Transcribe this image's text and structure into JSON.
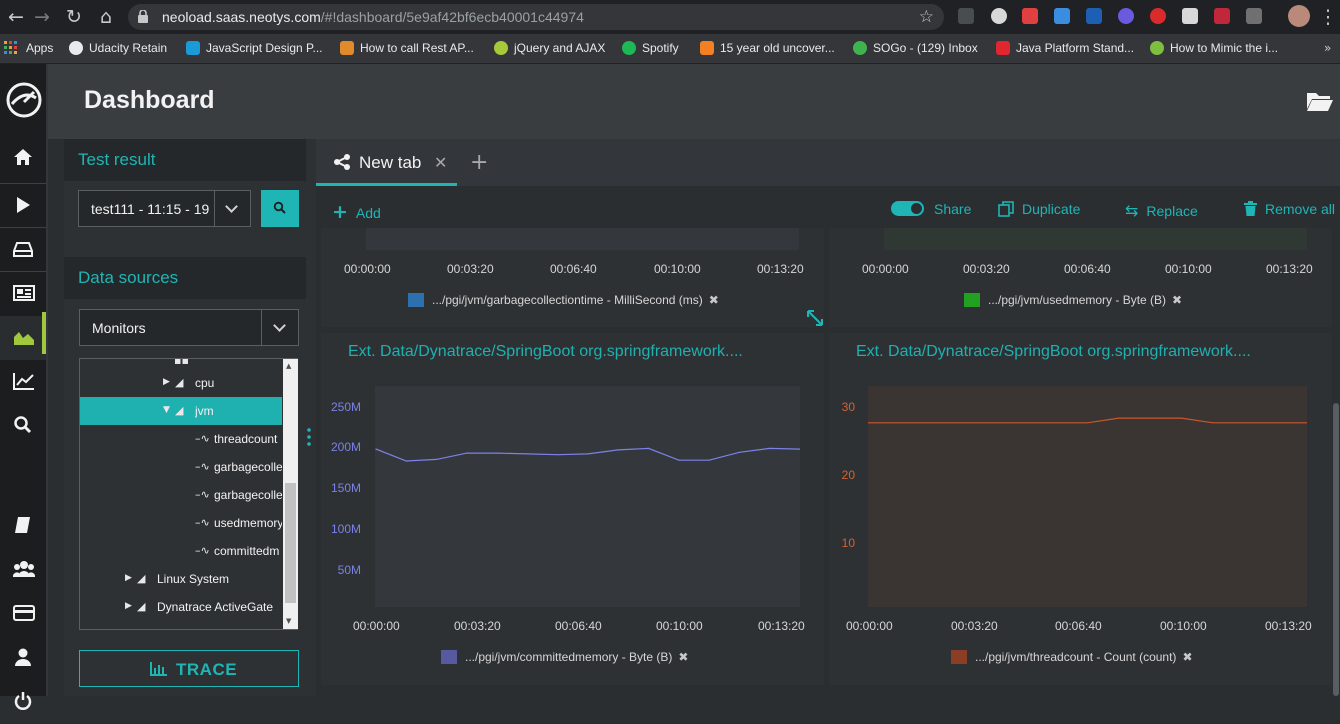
{
  "browser": {
    "url_host": "neoload.saas.neotys.com",
    "url_rest": "/#!dashboard/5e9af42bf6ecb40001c44974",
    "bookmarks": [
      {
        "label": "Apps",
        "color": "#e8a33c"
      },
      {
        "label": "Udacity Retain",
        "color": "#e8eaed"
      },
      {
        "label": "JavaScript Design P...",
        "color": "#1a9bd7"
      },
      {
        "label": "How to call Rest AP...",
        "color": "#e08a2b"
      },
      {
        "label": "jQuery and AJAX",
        "color": "#a6c93a"
      },
      {
        "label": "Spotify",
        "color": "#1db954"
      },
      {
        "label": "15 year old uncover...",
        "color": "#f48024"
      },
      {
        "label": "SOGo - (129) Inbox",
        "color": "#3fb34f"
      },
      {
        "label": "Java Platform Stand...",
        "color": "#e0262e"
      },
      {
        "label": "How to Mimic the i...",
        "color": "#7fbf3f"
      }
    ]
  },
  "app": {
    "title": "Dashboard"
  },
  "left_panel": {
    "test_result_heading": "Test result",
    "test_result_value": "test111 - 11:15 - 19",
    "data_sources_heading": "Data sources",
    "data_sources_value": "Monitors",
    "tree": [
      {
        "label": "cpu"
      },
      {
        "label": "jvm"
      },
      {
        "label": "threadcount"
      },
      {
        "label": "garbagecolle"
      },
      {
        "label": "garbagecolle"
      },
      {
        "label": "usedmemory"
      },
      {
        "label": "committedm"
      },
      {
        "label": "Linux System"
      },
      {
        "label": "Dynatrace ActiveGate"
      }
    ],
    "trace_label": "TRACE"
  },
  "tabs": {
    "active_label": "New tab"
  },
  "toolbar": {
    "add": "Add",
    "share": "Share",
    "duplicate": "Duplicate",
    "replace": "Replace",
    "remove_all": "Remove all"
  },
  "widgets": {
    "top_left": {
      "x_ticks": [
        "00:00:00",
        "00:03:20",
        "00:06:40",
        "00:10:00",
        "00:13:20"
      ],
      "legend": ".../pgi/jvm/garbagecollectiontime - MilliSecond (ms)",
      "color": "#2e6fae"
    },
    "top_right": {
      "x_ticks": [
        "00:00:00",
        "00:03:20",
        "00:06:40",
        "00:10:00",
        "00:13:20"
      ],
      "legend": ".../pgi/jvm/usedmemory - Byte (B)",
      "color": "#22a022"
    },
    "bottom_left": {
      "title": "Ext. Data/Dynatrace/SpringBoot org.springframework....",
      "y_ticks": [
        "250M",
        "200M",
        "150M",
        "100M",
        "50M"
      ],
      "x_ticks": [
        "00:00:00",
        "00:03:20",
        "00:06:40",
        "00:10:00",
        "00:13:20"
      ],
      "legend": ".../pgi/jvm/committedmemory - Byte (B)",
      "color": "#6c72d8"
    },
    "bottom_right": {
      "title": "Ext. Data/Dynatrace/SpringBoot org.springframework....",
      "y_ticks": [
        "30",
        "20",
        "10"
      ],
      "x_ticks": [
        "00:00:00",
        "00:03:20",
        "00:06:40",
        "00:10:00",
        "00:13:20"
      ],
      "legend": ".../pgi/jvm/threadcount - Count (count)",
      "color": "#c9562c"
    }
  },
  "chart_data": [
    {
      "type": "line",
      "x": [
        "00:00:00",
        "00:00:50",
        "00:01:40",
        "00:02:30",
        "00:03:20",
        "00:04:10",
        "00:05:00",
        "00:05:50",
        "00:06:40",
        "00:07:30",
        "00:08:20",
        "00:09:10",
        "00:10:00",
        "00:10:50",
        "00:11:40",
        "00:12:30",
        "00:13:20"
      ],
      "series": [
        {
          "name": ".../pgi/jvm/committedmemory - Byte (B)",
          "values": [
            200,
            185,
            187,
            195,
            195,
            194,
            193,
            194,
            199,
            201,
            186,
            186,
            196,
            201,
            200
          ]
        }
      ],
      "y_unit": "M",
      "ylim": [
        0,
        280
      ],
      "x_ticks": [
        "00:00:00",
        "00:03:20",
        "00:06:40",
        "00:10:00",
        "00:13:20"
      ]
    },
    {
      "type": "line",
      "x": [
        "00:00:00",
        "00:00:50",
        "00:01:40",
        "00:02:30",
        "00:03:20",
        "00:04:10",
        "00:05:00",
        "00:05:50",
        "00:06:40",
        "00:07:30",
        "00:08:20",
        "00:09:10",
        "00:10:00",
        "00:10:50",
        "00:11:40",
        "00:12:30",
        "00:13:20"
      ],
      "series": [
        {
          "name": ".../pgi/jvm/threadcount - Count (count)",
          "values": [
            27.5,
            27.5,
            27.5,
            27.5,
            27.5,
            27.5,
            27.5,
            27.5,
            28.2,
            28.2,
            28.2,
            27.5,
            27.5,
            27.5,
            27.5
          ]
        }
      ],
      "ylim": [
        0,
        33
      ],
      "x_ticks": [
        "00:00:00",
        "00:03:20",
        "00:06:40",
        "00:10:00",
        "00:13:20"
      ]
    }
  ]
}
